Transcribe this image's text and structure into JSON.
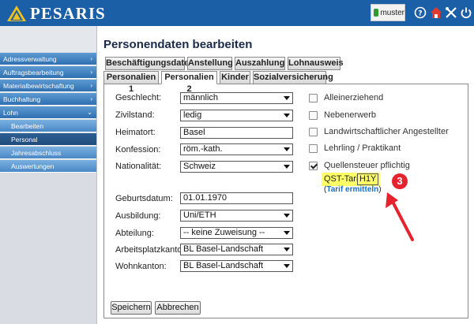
{
  "header": {
    "logo_text": "PESARIS",
    "username": "muster",
    "colors": {
      "bar": "#1b5fa6"
    },
    "icons": [
      "help-icon",
      "home-icon",
      "tools-icon",
      "power-icon"
    ]
  },
  "sidebar": {
    "items": [
      {
        "label": "Adressverwaltung",
        "chevron": "›"
      },
      {
        "label": "Auftragsbearbeitung",
        "chevron": "›"
      },
      {
        "label": "Materialbewirtschaftung",
        "chevron": "›"
      },
      {
        "label": "Buchhaltung",
        "chevron": "›"
      },
      {
        "label": "Lohn",
        "chevron": "⌄"
      }
    ],
    "subitems": [
      {
        "label": "Bearbeiten"
      },
      {
        "label": "Personal",
        "active": true
      },
      {
        "label": "Jahresabschluss"
      },
      {
        "label": "Auswertungen"
      }
    ]
  },
  "main": {
    "title": "Personendaten bearbeiten",
    "tabs_row1": [
      "Beschäftigungsdaten",
      "Anstellung",
      "Auszahlung",
      "Lohnausweis"
    ],
    "tabs_row2": [
      "Personalien 1",
      "Personalien 2",
      "Kinder",
      "Sozialversicherung"
    ],
    "active_tab": "Personalien 2"
  },
  "form": {
    "geschlecht": {
      "label": "Geschlecht:",
      "value": "männlich"
    },
    "zivilstand": {
      "label": "Zivilstand:",
      "value": "ledig"
    },
    "heimatort": {
      "label": "Heimatort:",
      "value": "Basel"
    },
    "konfession": {
      "label": "Konfession:",
      "value": "röm.-kath."
    },
    "nationalitaet": {
      "label": "Nationalität:",
      "value": "Schweiz"
    },
    "geburtsdatum": {
      "label": "Geburtsdatum:",
      "value": "01.01.1970"
    },
    "ausbildung": {
      "label": "Ausbildung:",
      "value": "Uni/ETH"
    },
    "abteilung": {
      "label": "Abteilung:",
      "value": "-- keine Zuweisung --"
    },
    "arbeitsplatzkanton": {
      "label": "Arbeitsplatzkanton:",
      "value": "BL Basel-Landschaft"
    },
    "wohnkanton": {
      "label": "Wohnkanton:",
      "value": "BL Basel-Landschaft"
    }
  },
  "checkboxes": [
    {
      "label": "Alleinerziehend",
      "checked": false
    },
    {
      "label": "Nebenerwerb",
      "checked": false
    },
    {
      "label": "Landwirtschaftlicher Angestellter",
      "checked": false
    },
    {
      "label": "Lehrling / Praktikant",
      "checked": false
    },
    {
      "label": "Quellensteuer pflichtig",
      "checked": true
    }
  ],
  "qst": {
    "label": "QST-Tarif:",
    "value": "H1Y",
    "link_prefix": "(",
    "link_text": "Tarif ermitteln",
    "link_suffix": ")",
    "highlight_color": "#ffff66"
  },
  "annotation": {
    "badge": "3",
    "color": "#e4232e"
  },
  "buttons": {
    "save": "Speichern",
    "cancel": "Abbrechen"
  }
}
